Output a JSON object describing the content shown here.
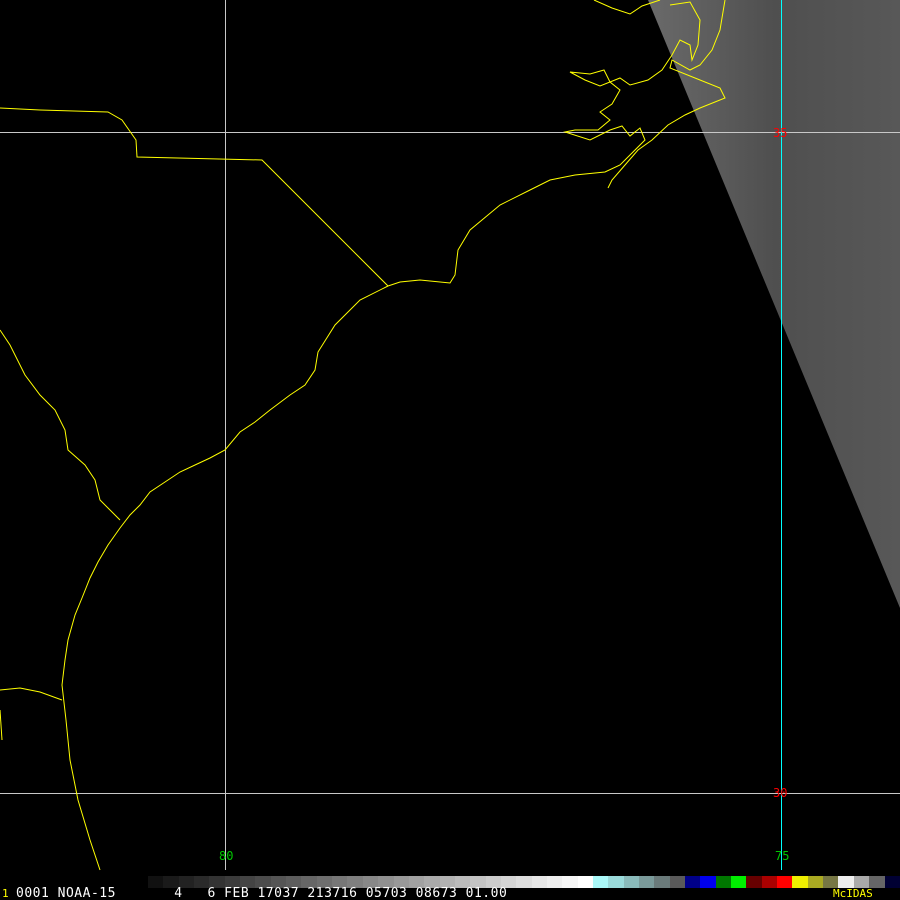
{
  "image": {
    "frame_number": "1",
    "info_line": "0001 NOAA-15       4   6 FEB 17037 213716 05703 08673 01.00",
    "brand": "McIDAS"
  },
  "grid_labels": {
    "lat_35": "35",
    "lat_30": "30",
    "lon_80": "80",
    "lon_75": "75"
  },
  "colors": {
    "coastline": "#ffff00",
    "grid": "#c8c8c8",
    "grid_highlight": "#00ffff",
    "lat_label": "#ff0000",
    "lon_label": "#00c800",
    "brand": "#ffff00"
  },
  "color_bar": [
    "#111",
    "#1a1a1a",
    "#222",
    "#2a2a2a",
    "#333",
    "#3b3b3b",
    "#444",
    "#4c4c4c",
    "#555",
    "#5d5d5d",
    "#666",
    "#6e6e6e",
    "#777",
    "#7f7f7f",
    "#888",
    "#909090",
    "#999",
    "#a1a1a1",
    "#aaa",
    "#b2b2b2",
    "#bbb",
    "#c3c3c3",
    "#ccc",
    "#d4d4d4",
    "#ddd",
    "#e6e6e6",
    "#eee",
    "#f6f6f6",
    "#fff",
    "#aaf8f8",
    "#9adada",
    "#8ababa",
    "#7a9a9a",
    "#6a7a7a",
    "#5a5a5a",
    "#000088",
    "#0000ee",
    "#007700",
    "#00ee00",
    "#660000",
    "#aa0000",
    "#ff0000",
    "#eeee00",
    "#aaaa22",
    "#777744",
    "#eeeeee",
    "#aaaaaa",
    "#666666",
    "#000033"
  ]
}
